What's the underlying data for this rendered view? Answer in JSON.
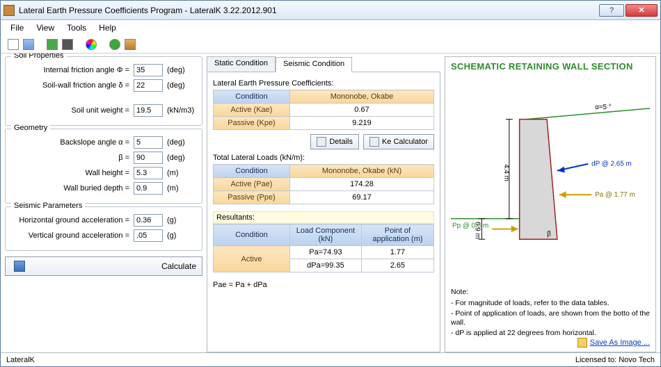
{
  "window": {
    "title": "Lateral Earth Pressure Coefficients Program - LateralK 3.22.2012.901"
  },
  "menu": {
    "file": "File",
    "view": "View",
    "tools": "Tools",
    "help": "Help"
  },
  "toolbar_icons": [
    "new",
    "table",
    "import",
    "print",
    "color",
    "help",
    "exit"
  ],
  "soil": {
    "legend": "Soil Properties",
    "phi_label": "Internal friction angle   Φ =",
    "phi": "35",
    "deg": "(deg)",
    "delta_label": "Soil-wall friction angle   δ =",
    "delta": "22",
    "gamma_label": "Soil unit weight =",
    "gamma": "19.5",
    "gamma_unit": "(kN/m3)"
  },
  "geom": {
    "legend": "Geometry",
    "alpha_label": "Backslope angle   α =",
    "alpha": "5",
    "beta_label": "β =",
    "beta": "90",
    "h_label": "Wall height =",
    "h": "5.3",
    "m": "(m)",
    "d_label": "Wall buried depth =",
    "d": "0.9"
  },
  "seis": {
    "legend": "Seismic Parameters",
    "ah_label": "Horizontal ground acceleration =",
    "ah": "0.36",
    "g": "(g)",
    "av_label": "Vertical ground acceleration =",
    "av": ".05"
  },
  "calc_label": "Calculate",
  "tabs": {
    "static": "Static Condition",
    "seismic": "Seismic Condition"
  },
  "coeff": {
    "title": "Lateral Earth Pressure Coefficients:",
    "hdr_cond": "Condition",
    "hdr_mo": "Mononobe, Okabe",
    "rows": [
      {
        "cond": "Active (Kae)",
        "val": "0.67"
      },
      {
        "cond": "Passive (Kpe)",
        "val": "9.219"
      }
    ],
    "details": "Details",
    "kecalc": "Ke Calculator"
  },
  "loads": {
    "title": "Total Lateral Loads (kN/m):",
    "hdr_cond": "Condition",
    "hdr_mo": "Mononobe, Okabe (kN)",
    "rows": [
      {
        "cond": "Active (Pae)",
        "val": "174.28"
      },
      {
        "cond": "Passive (Ppe)",
        "val": "69.17"
      }
    ]
  },
  "resultants": {
    "title": "Resultants:",
    "hdr_cond": "Condition",
    "hdr_load": "Load Component (kN)",
    "hdr_pt": "Point of application (m)",
    "cond": "Active",
    "r1_load": "Pa=74.93",
    "r1_pt": "1.77",
    "r2_load": "dPa=99.35",
    "r2_pt": "2.65",
    "note": "Pae = Pa + dPa"
  },
  "schematic": {
    "title": "SCHEMATIC RETAINING WALL SECTION",
    "alpha_label": "α=5 °",
    "h_dim": "4.4 m",
    "d_dim": "0.9 m",
    "dp_label": "dP @ 2.65 m",
    "pa_label": "Pa @ 1.77 m",
    "pp_label": "Pp @ 0.6 m",
    "beta_sym": "β",
    "note_hdr": "Note:",
    "note1": "- For magnitude of loads, refer to the data tables.",
    "note2": "- Point of application of loads, are shown from the botto of the wall.",
    "note3": "- dP is applied at 22 degrees from horizontal.",
    "save": "Save As Image ..."
  },
  "status": {
    "left": "LateralK",
    "right": "Licensed to: Novo Tech"
  },
  "chart_data": {
    "type": "diagram",
    "wall_height_m": 5.3,
    "buried_depth_m": 0.9,
    "above_ground_height_m": 4.4,
    "backslope_angle_deg": 5,
    "wall_angle_beta_deg": 90,
    "forces": [
      {
        "name": "dP",
        "elevation_m": 2.65,
        "side": "right"
      },
      {
        "name": "Pa",
        "elevation_m": 1.77,
        "side": "right"
      },
      {
        "name": "Pp",
        "elevation_m": 0.6,
        "side": "left"
      }
    ]
  }
}
